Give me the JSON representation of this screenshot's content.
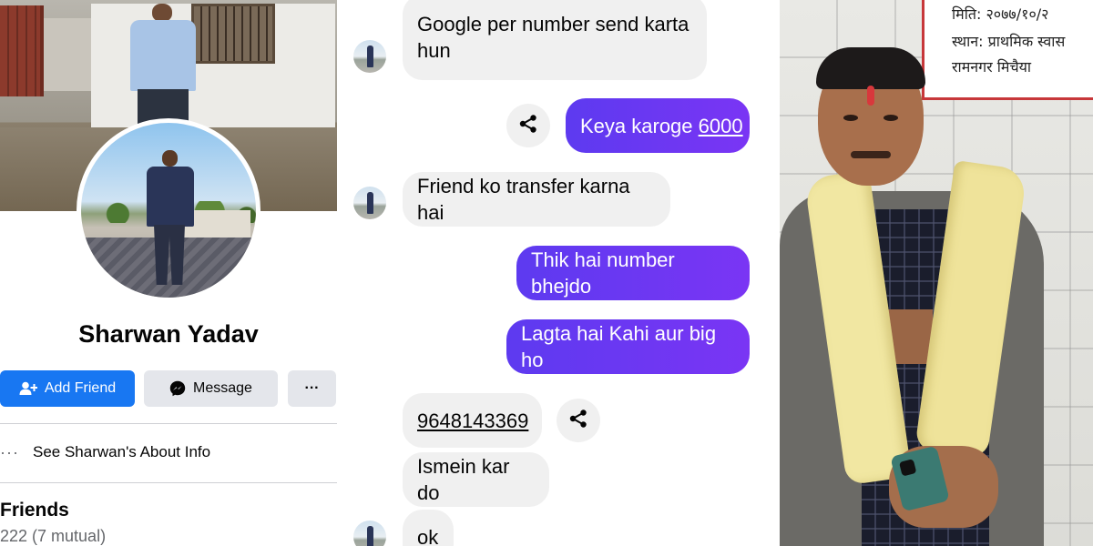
{
  "profile": {
    "name": "Sharwan Yadav",
    "add_friend_label": "Add Friend",
    "message_label": "Message",
    "more_label": "···",
    "about_dots": "···",
    "about_label": "See Sharwan's About Info",
    "friends_title": "Friends",
    "friends_count": "222 (7 mutual)"
  },
  "chat": {
    "messages": [
      {
        "direction": "incoming",
        "line1": "Google per number send karta",
        "line2": "hun"
      },
      {
        "direction": "outgoing",
        "text_prefix": "Keya karoge ",
        "text_link": "6000"
      },
      {
        "direction": "incoming",
        "text": "Friend ko transfer karna hai"
      },
      {
        "direction": "outgoing",
        "text": "Thik hai number bhejdo"
      },
      {
        "direction": "outgoing",
        "text": "Lagta hai Kahi aur big ho"
      },
      {
        "direction": "incoming",
        "text_link": "9648143369"
      },
      {
        "direction": "incoming",
        "text": "Ismein kar do"
      },
      {
        "direction": "incoming",
        "text": "ok"
      }
    ]
  },
  "photo": {
    "notice_line1": "मिति: २०७७/१०/२",
    "notice_line2": "स्थान: प्राथमिक स्वास",
    "notice_line3": "रामनगर मिचैया"
  },
  "colors": {
    "facebook_blue": "#1877f2",
    "outgoing_bubble": "#6d33f2",
    "incoming_bubble": "#f0f0f0",
    "button_gray": "#e4e6eb"
  }
}
